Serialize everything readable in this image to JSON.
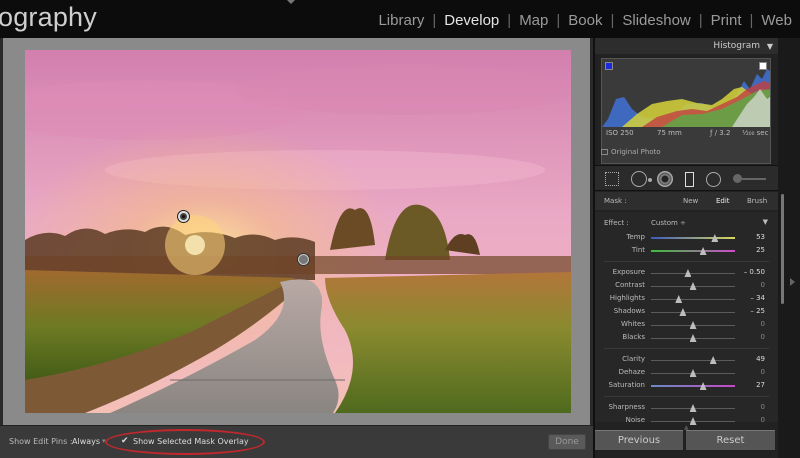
{
  "app": {
    "title": "ography",
    "modules": [
      {
        "label": "Library",
        "active": false
      },
      {
        "label": "Develop",
        "active": true
      },
      {
        "label": "Map",
        "active": false
      },
      {
        "label": "Book",
        "active": false
      },
      {
        "label": "Slideshow",
        "active": false
      },
      {
        "label": "Print",
        "active": false
      },
      {
        "label": "Web",
        "active": false
      }
    ],
    "separator": "|"
  },
  "toolbar": {
    "edit_pins_label": "Show Edit Pins :",
    "edit_pins_value": "Always",
    "edit_pins_caret": "▾",
    "overlay_check": "✔",
    "overlay_label": "Show Selected Mask Overlay",
    "done_label": "Done"
  },
  "histogram": {
    "title": "Histogram",
    "toggle": "▼",
    "iso": "ISO 250",
    "focal": "75 mm",
    "aperture": "ƒ / 3.2",
    "shutter": "¹⁄₂₀₀ sec",
    "original_photo": "Original Photo"
  },
  "mask": {
    "label": "Mask :",
    "new_label": "New",
    "edit_label": "Edit",
    "brush_label": "Brush"
  },
  "effect": {
    "label": "Effect :",
    "preset": "Custom ÷",
    "toggle": "▼"
  },
  "sliders": [
    {
      "label": "Temp",
      "value": "53",
      "level": 0.76,
      "kind": "temp"
    },
    {
      "label": "Tint",
      "value": "25",
      "level": 0.62,
      "kind": "tint"
    },
    {
      "label": "Exposure",
      "value": "– 0.50",
      "level": 0.44,
      "kind": "plain"
    },
    {
      "label": "Contrast",
      "value": "0",
      "level": 0.5,
      "kind": "plain"
    },
    {
      "label": "Highlights",
      "value": "– 34",
      "level": 0.33,
      "kind": "plain"
    },
    {
      "label": "Shadows",
      "value": "– 25",
      "level": 0.38,
      "kind": "plain"
    },
    {
      "label": "Whites",
      "value": "0",
      "level": 0.5,
      "kind": "plain"
    },
    {
      "label": "Blacks",
      "value": "0",
      "level": 0.5,
      "kind": "plain"
    },
    {
      "label": "Clarity",
      "value": "49",
      "level": 0.74,
      "kind": "plain"
    },
    {
      "label": "Dehaze",
      "value": "0",
      "level": 0.5,
      "kind": "plain"
    },
    {
      "label": "Saturation",
      "value": "27",
      "level": 0.62,
      "kind": "sat"
    },
    {
      "label": "Sharpness",
      "value": "0",
      "level": 0.5,
      "kind": "plain"
    },
    {
      "label": "Noise",
      "value": "0",
      "level": 0.5,
      "kind": "plain"
    }
  ],
  "buttons": {
    "previous": "Previous",
    "reset": "Reset"
  }
}
